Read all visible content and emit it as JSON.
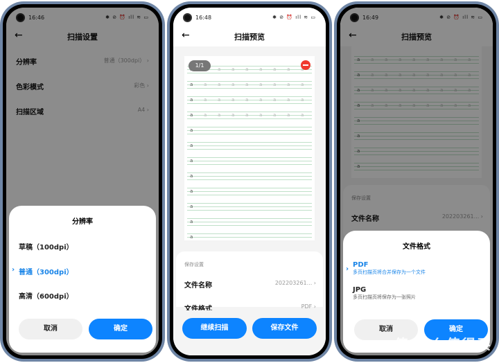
{
  "phone1": {
    "time": "16:46",
    "status_icons": "✱ ⊘ ⏰ ıll ≋ ▭",
    "title": "扫描设置",
    "rows": [
      {
        "label": "分辨率",
        "value": "普通（300dpi）"
      },
      {
        "label": "色彩模式",
        "value": "彩色"
      },
      {
        "label": "扫描区域",
        "value": "A4"
      }
    ],
    "sheet": {
      "title": "分辨率",
      "options": [
        "草稿（100dpi）",
        "普通（300dpi）",
        "高清（600dpi）"
      ],
      "selected": 1,
      "cancel": "取消",
      "confirm": "确定"
    }
  },
  "phone2": {
    "time": "16:48",
    "status_icons": "✱ ⊘ ⏰ ıll ≋ ▭",
    "title": "扫描预览",
    "page_counter": "1/1",
    "glyph": "a",
    "section": "保存设置",
    "rows": [
      {
        "label": "文件名称",
        "value": "202203261..."
      },
      {
        "label": "文件格式",
        "value": "PDF"
      }
    ],
    "continue": "继续扫描",
    "save": "保存文件"
  },
  "phone3": {
    "time": "16:49",
    "status_icons": "✱ ⊘ ⏰ ıll ≋ ▭",
    "title": "扫描预览",
    "glyph": "a",
    "section": "保存设置",
    "row": {
      "label": "文件名称",
      "value": "202203261..."
    },
    "sheet": {
      "title": "文件格式",
      "options": [
        {
          "name": "PDF",
          "desc": "多页扫描页将合并保存为一个文件"
        },
        {
          "name": "JPG",
          "desc": "多页扫描页将保存为一张照片"
        }
      ],
      "selected": 0,
      "cancel": "取消",
      "confirm": "确定"
    }
  },
  "watermark": "值 什么值得买",
  "colors": {
    "accent": "#0d84ff",
    "delete": "#f03a2e"
  }
}
